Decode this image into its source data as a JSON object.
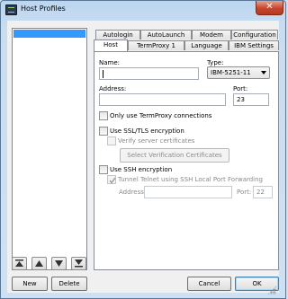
{
  "window": {
    "title": "Host Profiles",
    "close_glyph": "✕"
  },
  "tabs": {
    "row_back": [
      "Autologin",
      "AutoLaunch",
      "Modem",
      "Configuration"
    ],
    "row_front": [
      "Host",
      "TermProxy 1",
      "Language",
      "IBM Settings"
    ]
  },
  "host": {
    "name_label": "Name:",
    "name_value": "",
    "type_label": "Type:",
    "type_value": "IBM-5251-11",
    "address_label": "Address:",
    "address_value": "",
    "port_label": "Port:",
    "port_value": "23",
    "termproxy_label": "Only use TermProxy connections",
    "ssl_label": "Use SSL/TLS encryption",
    "verify_label": "Verify server certificates",
    "select_cert_button": "Select Verification Certificates",
    "ssh_label": "Use SSH encryption",
    "tunnel_label": "Tunnel Telnet using SSH Local Port Forwarding",
    "tunnel_address_label": "Address:",
    "tunnel_address_value": "",
    "tunnel_port_label": "Port:",
    "tunnel_port_value": "22"
  },
  "buttons": {
    "new": "New",
    "delete": "Delete",
    "cancel": "Cancel",
    "ok": "OK"
  },
  "icons": {
    "nav": [
      "move-top-icon",
      "move-up-icon",
      "move-down-icon",
      "move-bottom-icon"
    ],
    "app": "terminal-app-icon"
  },
  "colors": {
    "selection": "#3399ff",
    "close": "#c5452d",
    "title_bg": "#bcd6f0"
  }
}
